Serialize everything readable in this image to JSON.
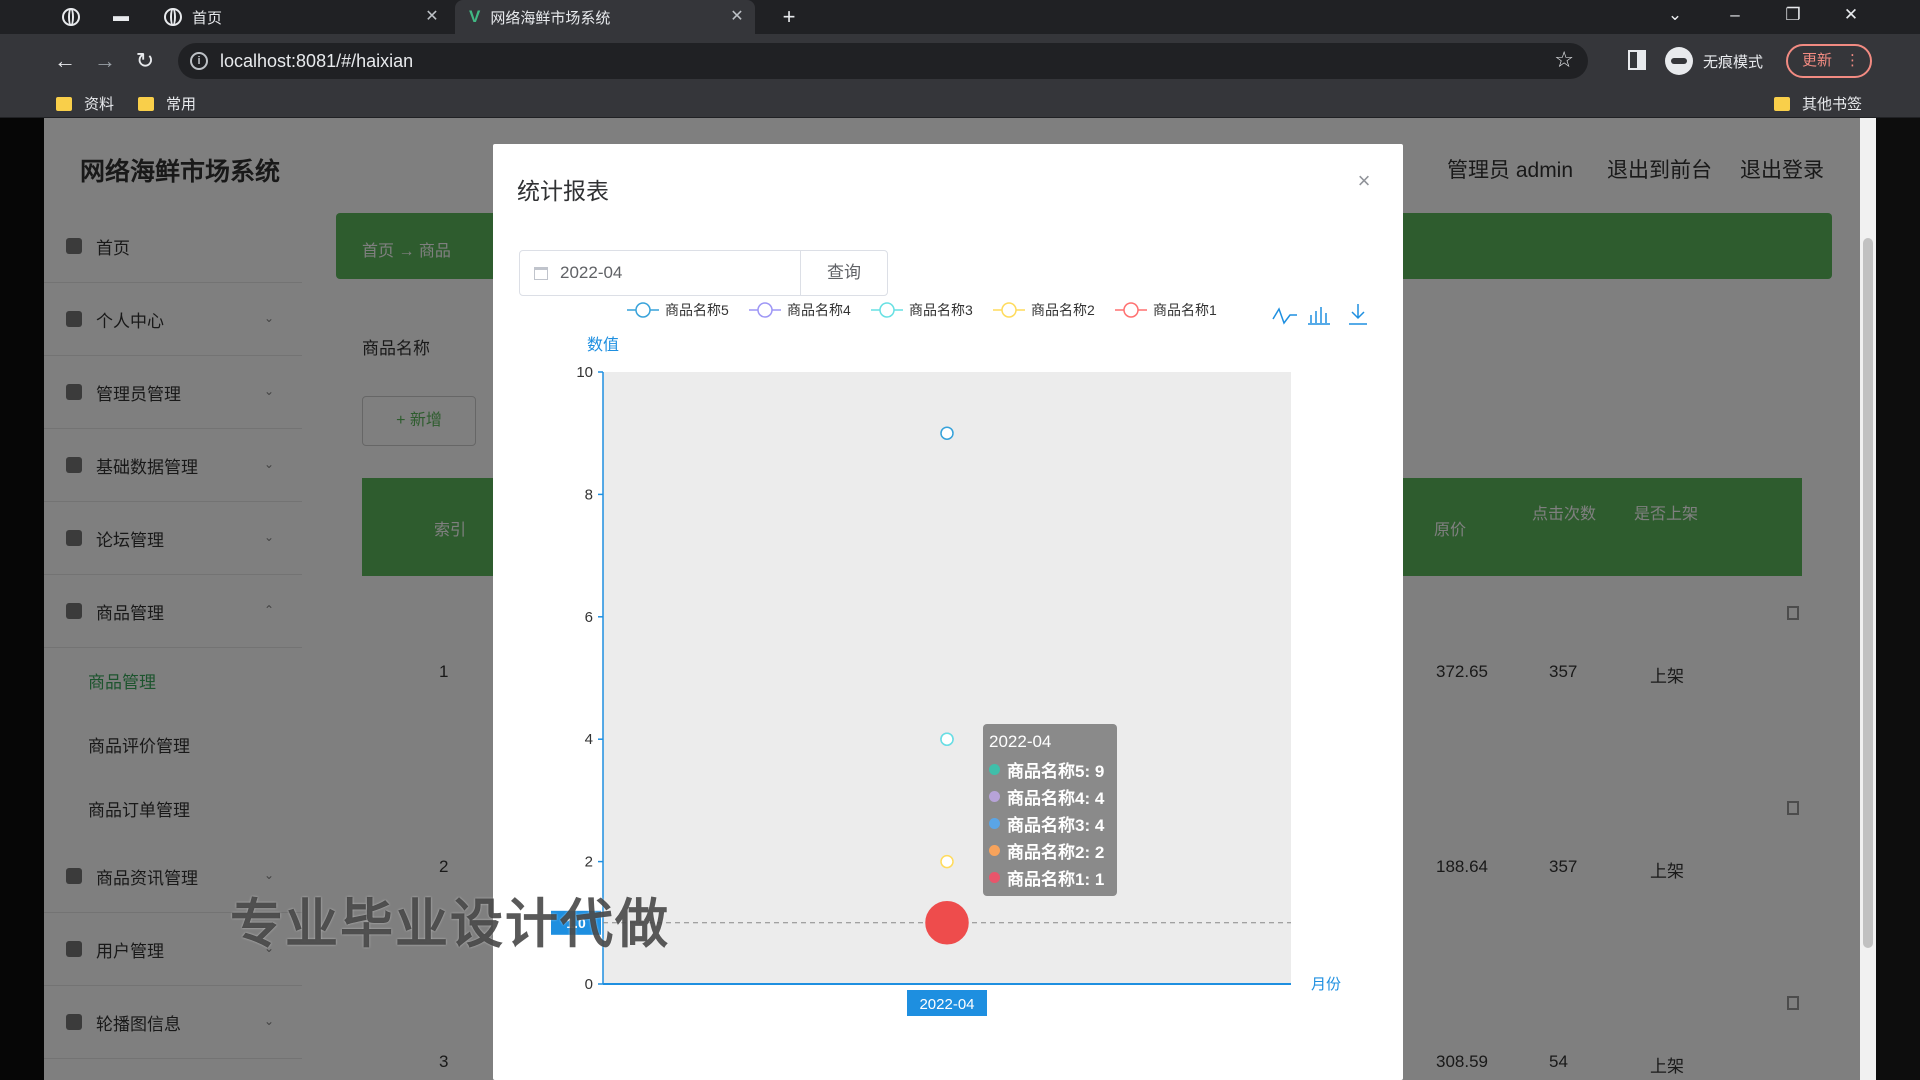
{
  "browser": {
    "tabs": [
      {
        "label": "首页",
        "active": false
      },
      {
        "label": "网络海鲜市场系统",
        "active": true
      }
    ],
    "new_tab": "+",
    "address": "localhost:8081/#/haixian",
    "incognito_label": "无痕模式",
    "update_label": "更新",
    "bookmarks": [
      "资料",
      "常用"
    ],
    "other_bookmarks": "其他书签"
  },
  "app": {
    "title": "网络海鲜市场系统",
    "header_links": [
      "管理员 admin",
      "退出到前台",
      "退出登录"
    ],
    "sidebar": [
      {
        "label": "首页",
        "icon": "home-icon"
      },
      {
        "label": "个人中心",
        "icon": "user-icon"
      },
      {
        "label": "管理员管理",
        "icon": "admin-icon"
      },
      {
        "label": "基础数据管理",
        "icon": "settings-icon"
      },
      {
        "label": "论坛管理",
        "icon": "forum-icon"
      },
      {
        "label": "商品管理",
        "icon": "list-icon"
      }
    ],
    "sidebar_sub": [
      "商品管理",
      "商品评价管理",
      "商品订单管理"
    ],
    "sidebar_after": [
      {
        "label": "商品资讯管理",
        "icon": "clock-icon"
      },
      {
        "label": "用户管理",
        "icon": "list-icon"
      },
      {
        "label": "轮播图信息",
        "icon": "image-icon"
      }
    ],
    "breadcrumb": "首页 → 商品",
    "filter_label": "商品名称",
    "add_button": "+ 新增",
    "table_headers": [
      "索引",
      "原价",
      "点击次数",
      "是否上架"
    ],
    "rows": [
      {
        "index": "1",
        "price": "372.65",
        "clicks": "357",
        "status": "上架"
      },
      {
        "index": "2",
        "price": "188.64",
        "clicks": "357",
        "status": "上架"
      },
      {
        "index": "3",
        "price": "308.59",
        "clicks": "54",
        "status": "上架"
      }
    ]
  },
  "modal": {
    "title": "统计报表",
    "close": "×",
    "date_value": "2022-04",
    "query_button": "查询"
  },
  "chart_data": {
    "type": "scatter",
    "x": [
      "2022-04"
    ],
    "series": [
      {
        "name": "商品名称5",
        "values": [
          9
        ],
        "color": "#37a2da"
      },
      {
        "name": "商品名称4",
        "values": [
          4
        ],
        "color": "#9d96f5"
      },
      {
        "name": "商品名称3",
        "values": [
          4
        ],
        "color": "#67e0e3"
      },
      {
        "name": "商品名称2",
        "values": [
          2
        ],
        "color": "#ffdb5c"
      },
      {
        "name": "商品名称1",
        "values": [
          1
        ],
        "color": "#ff7070"
      }
    ],
    "ylabel": "数值",
    "xlabel": "月份",
    "ylim": [
      0,
      10
    ],
    "yticks": [
      0,
      2,
      4,
      6,
      8,
      10
    ],
    "legend_position": "top",
    "axis_pointer_label": "1.0",
    "tooltip": {
      "title": "2022-04",
      "rows": [
        "商品名称5: 9",
        "商品名称4: 4",
        "商品名称3: 4",
        "商品名称2: 2",
        "商品名称1: 1"
      ],
      "dot_colors": [
        "#3fbfaa",
        "#b7a3d8",
        "#5aa5e6",
        "#f7a35c",
        "#e8556b"
      ]
    }
  },
  "watermark": "专业毕业设计代做"
}
